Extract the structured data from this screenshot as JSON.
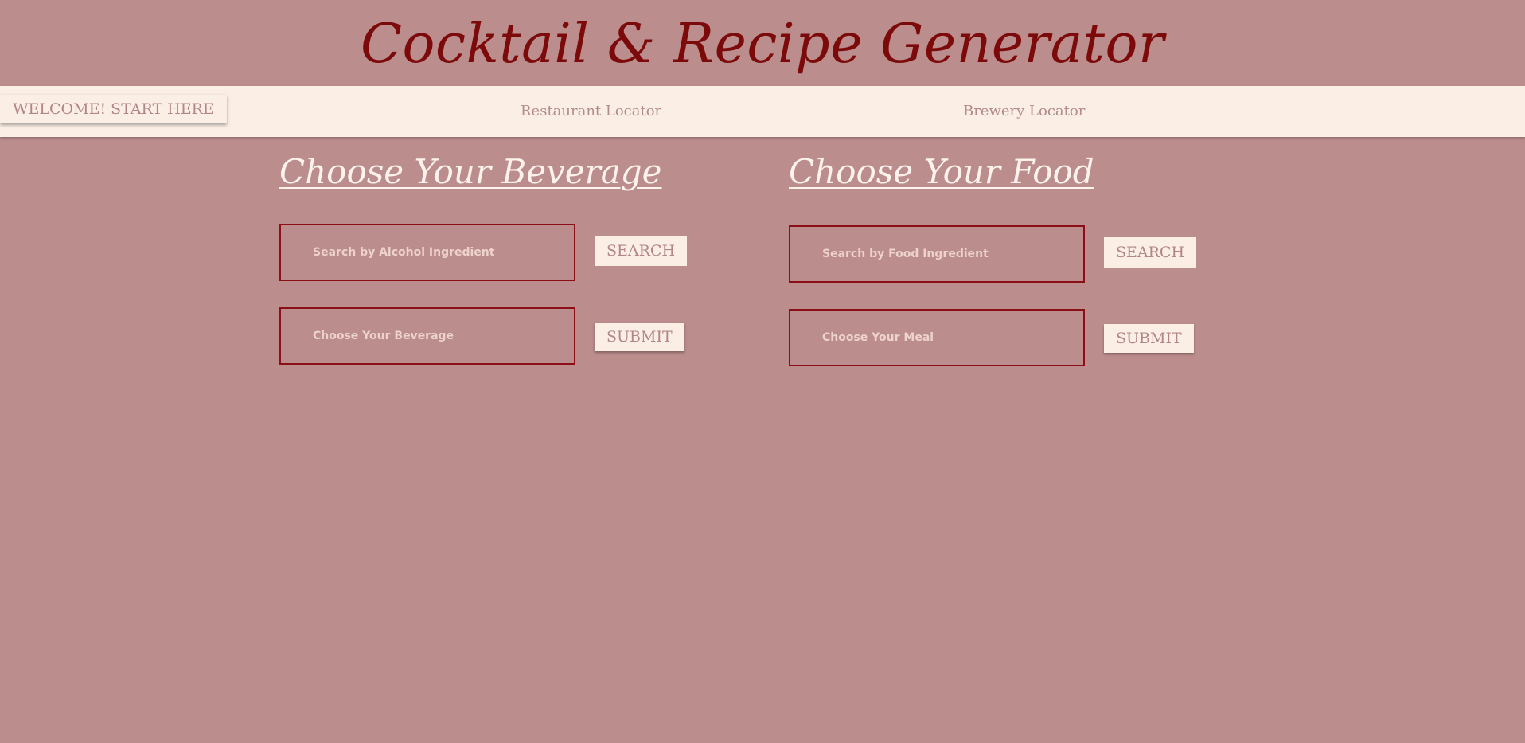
{
  "header": {
    "title": "Cocktail & Recipe Generator"
  },
  "nav": {
    "welcome_label": "WELCOME! START HERE",
    "restaurant_label": "Restaurant Locator",
    "brewery_label": "Brewery Locator"
  },
  "beverage": {
    "heading": "Choose Your Beverage",
    "search_placeholder": "Search by Alcohol Ingredient",
    "search_value": "",
    "search_button": "SEARCH",
    "choose_placeholder": "Choose Your Beverage",
    "choose_value": "",
    "submit_button": "SUBMIT"
  },
  "food": {
    "heading": "Choose Your Food",
    "search_placeholder": "Search by Food Ingredient",
    "search_value": "",
    "search_button": "SEARCH",
    "choose_placeholder": "Choose Your Meal",
    "choose_value": "",
    "submit_button": "SUBMIT"
  },
  "colors": {
    "background": "#bb8d8d",
    "title": "#7d0a0a",
    "navbar": "#fbefe5",
    "input_border": "#8c0f18",
    "button_text": "#b38686",
    "heading_text": "#fdf3ec"
  }
}
